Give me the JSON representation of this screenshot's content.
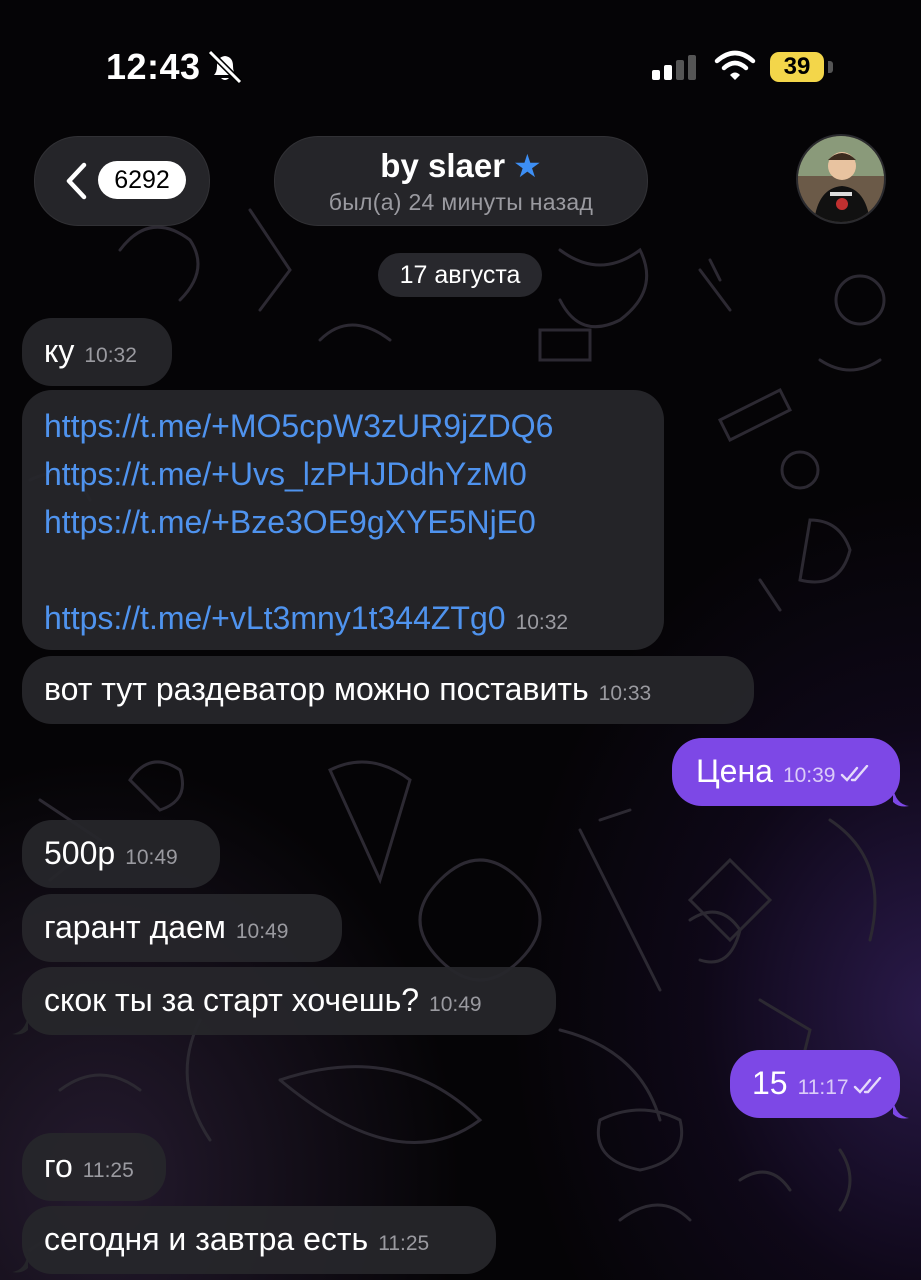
{
  "status_bar": {
    "time": "12:43",
    "battery": "39"
  },
  "header": {
    "unread_count": "6292",
    "chat_name": "by slaer",
    "chat_status": "был(а) 24 минуты назад"
  },
  "date_separator": "17 августа",
  "messages": [
    {
      "dir": "in",
      "text": "ку",
      "time": "10:32"
    },
    {
      "dir": "in",
      "links": [
        "https://t.me/+MO5cpW3zUR9jZDQ6",
        "https://t.me/+Uvs_lzPHJDdhYzM0",
        "https://t.me/+Bze3OE9gXYE5NjE0",
        "https://t.me/+vLt3mny1t344ZTg0"
      ],
      "time": "10:32"
    },
    {
      "dir": "in",
      "text": "вот тут раздеватор можно поставить",
      "time": "10:33"
    },
    {
      "dir": "out",
      "text": "Цена",
      "time": "10:39"
    },
    {
      "dir": "in",
      "text": "500р",
      "time": "10:49"
    },
    {
      "dir": "in",
      "text": "гарант даем",
      "time": "10:49"
    },
    {
      "dir": "in",
      "text": "скок ты за старт хочешь?",
      "time": "10:49"
    },
    {
      "dir": "out",
      "text": "15",
      "time": "11:17"
    },
    {
      "dir": "in",
      "text": "го",
      "time": "11:25"
    },
    {
      "dir": "in",
      "text": "сегодня и завтра есть",
      "time": "11:25"
    }
  ],
  "colors": {
    "outgoing": "#7d48e6",
    "incoming": "#26262a",
    "link": "#4f93ee",
    "star": "#3d8ff5",
    "battery": "#f3d64a"
  },
  "icons": [
    "bell-slash-icon",
    "signal-icon",
    "wifi-icon",
    "back-chevron-icon",
    "star-icon",
    "double-check-icon"
  ]
}
